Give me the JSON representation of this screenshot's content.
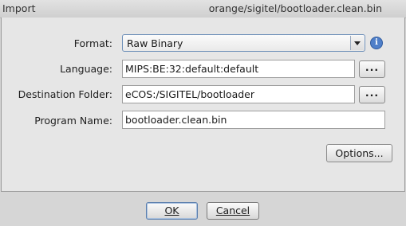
{
  "window": {
    "title": "Import",
    "subtitle": "orange/sigitel/bootloader.clean.bin"
  },
  "form": {
    "format": {
      "label": "Format:",
      "value": "Raw Binary"
    },
    "language": {
      "label": "Language:",
      "value": "MIPS:BE:32:default:default",
      "browse": "..."
    },
    "destination": {
      "label": "Destination Folder:",
      "value": "eCOS:/SIGITEL/bootloader",
      "browse": "..."
    },
    "program_name": {
      "label": "Program Name:",
      "value": "bootloader.clean.bin"
    },
    "options_label": "Options..."
  },
  "buttons": {
    "ok": "OK",
    "cancel": "Cancel"
  },
  "icons": {
    "info": "info-icon"
  }
}
